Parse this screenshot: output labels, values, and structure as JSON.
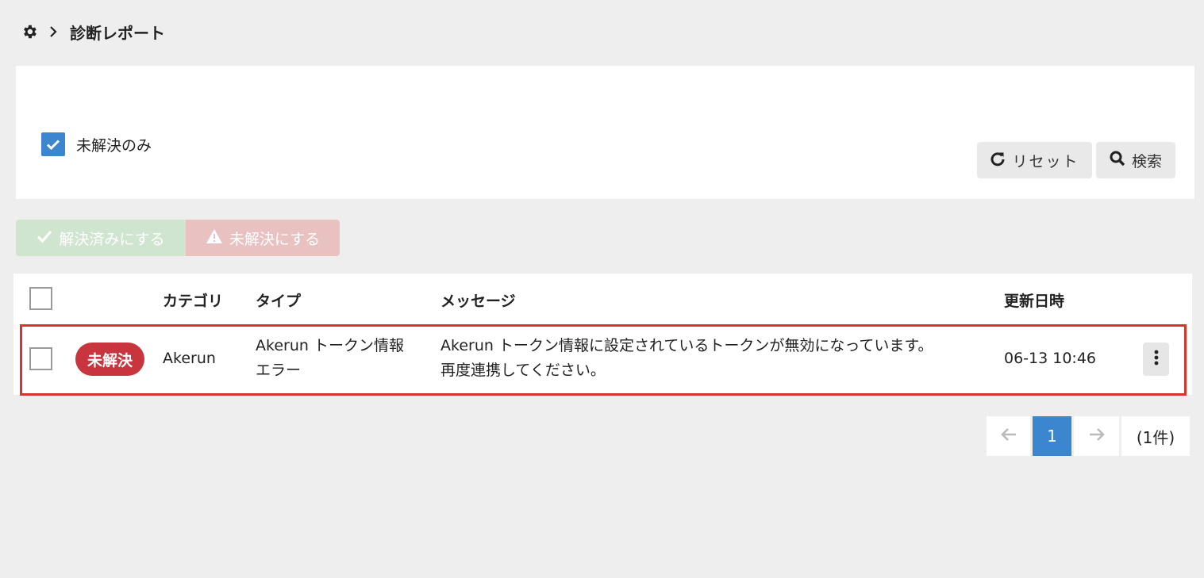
{
  "breadcrumb": {
    "home_icon": "gear-icon",
    "separator_icon": "chevron-right-icon",
    "title": "診断レポート"
  },
  "filters": {
    "unresolved_only_label": "未解決のみ",
    "unresolved_only_checked": true,
    "reset_label": "リセット",
    "search_label": "検索"
  },
  "bulk_actions": {
    "resolve_label": "解決済みにする",
    "unresolve_label": "未解決にする",
    "resolve_color": "#cfe5cf",
    "unresolve_color": "#e9c1c1"
  },
  "table": {
    "columns": {
      "category": "カテゴリ",
      "type": "タイプ",
      "message": "メッセージ",
      "updated_at": "更新日時"
    },
    "rows": [
      {
        "status": "未解決",
        "status_color": "#c9353e",
        "category": "Akerun",
        "type_line1": "Akerun トークン情報",
        "type_line2": "エラー",
        "message_line1": "Akerun トークン情報に設定されているトークンが無効になっています。",
        "message_line2": "再度連携してください。",
        "updated_at": "06-13 10:46",
        "highlighted": true
      }
    ]
  },
  "pagination": {
    "current_page": "1",
    "total_label": "(1件)",
    "accent_color": "#3b86cf"
  }
}
